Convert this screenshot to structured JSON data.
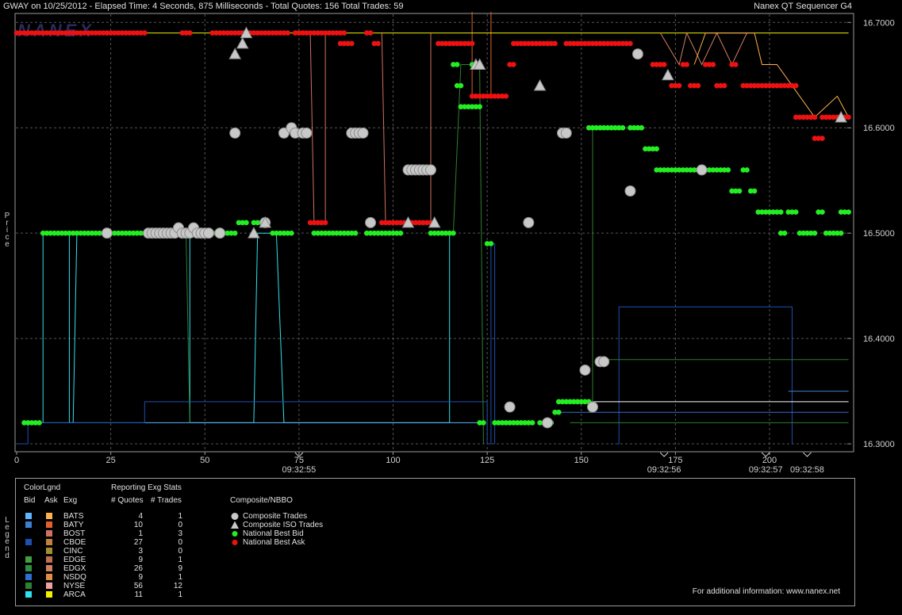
{
  "header": {
    "title": "GWAY on 10/25/2012  -  Elapsed Time: 4 Seconds, 875 Milliseconds  -  Total Quotes: 156  Total Trades: 59",
    "app_name": "Nanex QT Sequencer G4",
    "logo_text": "NANEX"
  },
  "axis_labels": {
    "y": "Price",
    "legend_side": "Legend"
  },
  "legend": {
    "colorlgnd_title": "ColorLgnd",
    "stats_title": "Reporting Exg Stats",
    "col_bid": "Bid",
    "col_ask": "Ask",
    "col_exg": "Exg",
    "col_quotes": "# Quotes",
    "col_trades": "# Trades",
    "composite_title": "Composite/NBBO",
    "rows": [
      {
        "exg": "BATS",
        "quotes": "4",
        "trades": "1",
        "bid_color": "#5fb4ff",
        "ask_color": "#ffb050"
      },
      {
        "exg": "BATY",
        "quotes": "10",
        "trades": "0",
        "bid_color": "#3f7fd0",
        "ask_color": "#e06030"
      },
      {
        "exg": "BOST",
        "quotes": "1",
        "trades": "3",
        "bid_color": "#000000",
        "ask_color": "#d07060"
      },
      {
        "exg": "CBOE",
        "quotes": "27",
        "trades": "0",
        "bid_color": "#1f4fb0",
        "ask_color": "#c08040"
      },
      {
        "exg": "CINC",
        "quotes": "3",
        "trades": "0",
        "bid_color": "#000000",
        "ask_color": "#a09030"
      },
      {
        "exg": "EDGE",
        "quotes": "9",
        "trades": "1",
        "bid_color": "#3fa040",
        "ask_color": "#c07050"
      },
      {
        "exg": "EDGX",
        "quotes": "26",
        "trades": "9",
        "bid_color": "#2f8f40",
        "ask_color": "#d08060"
      },
      {
        "exg": "NSDQ",
        "quotes": "9",
        "trades": "1",
        "bid_color": "#2f6fd0",
        "ask_color": "#e09040"
      },
      {
        "exg": "NYSE",
        "quotes": "56",
        "trades": "12",
        "bid_color": "#2f7f30",
        "ask_color": "#f0a0a0"
      },
      {
        "exg": "ARCA",
        "quotes": "11",
        "trades": "1",
        "bid_color": "#30e0f0",
        "ask_color": "#f0f000"
      }
    ],
    "composite": [
      {
        "label": "Composite Trades",
        "marker": "circle",
        "color": "#c8c8c8"
      },
      {
        "label": "Composite ISO Trades",
        "marker": "triangle",
        "color": "#c8c8c8"
      },
      {
        "label": "National Best Bid",
        "marker": "dot",
        "color": "#22ee22"
      },
      {
        "label": "National Best Ask",
        "marker": "dot",
        "color": "#ee1111"
      }
    ],
    "footer": "For additional information: www.nanex.net"
  },
  "colors": {
    "bid": "#22ee22",
    "ask": "#ee1111",
    "trade": "#c8c8c8",
    "grid": "#555555"
  },
  "chart_data": {
    "type": "scatter",
    "x_ticks": [
      "0",
      "25",
      "50",
      "75",
      "100",
      "125",
      "150",
      "175",
      "200"
    ],
    "y_ticks": [
      "16.3000",
      "16.4000",
      "16.5000",
      "16.6000",
      "16.7000"
    ],
    "time_labels": [
      {
        "x": 75,
        "label": "09:32:55"
      },
      {
        "x": 172,
        "label": "09:32:56"
      },
      {
        "x": 199,
        "label": "09:32:57"
      },
      {
        "x": 210,
        "label": "09:32:58"
      }
    ],
    "xlim": [
      0,
      221
    ],
    "ylim": [
      16.2925,
      16.7085
    ],
    "ask_segments": [
      [
        0,
        24,
        16.69
      ],
      [
        24,
        34,
        16.69
      ],
      [
        44,
        46,
        16.69
      ],
      [
        52,
        60,
        16.69
      ],
      [
        61,
        72,
        16.69
      ],
      [
        74,
        80,
        16.69
      ],
      [
        81,
        84,
        16.69
      ],
      [
        85,
        87,
        16.69
      ],
      [
        78,
        82,
        16.51
      ],
      [
        86,
        89,
        16.68
      ],
      [
        93,
        94,
        16.69
      ],
      [
        95,
        96,
        16.68
      ],
      [
        97,
        103,
        16.51
      ],
      [
        104,
        110,
        16.51
      ],
      [
        112,
        121,
        16.68
      ],
      [
        121,
        126,
        16.63
      ],
      [
        126,
        130,
        16.63
      ],
      [
        131,
        132,
        16.66
      ],
      [
        132,
        137,
        16.68
      ],
      [
        138,
        143,
        16.68
      ],
      [
        146,
        152,
        16.68
      ],
      [
        153,
        163,
        16.68
      ],
      [
        169,
        172,
        16.66
      ],
      [
        174,
        176,
        16.64
      ],
      [
        177,
        178,
        16.66
      ],
      [
        179,
        181,
        16.64
      ],
      [
        183,
        185,
        16.66
      ],
      [
        186,
        188,
        16.64
      ],
      [
        190,
        191,
        16.66
      ],
      [
        193,
        196,
        16.64
      ],
      [
        196,
        207,
        16.64
      ],
      [
        207,
        212,
        16.61
      ],
      [
        212,
        214,
        16.59
      ],
      [
        214,
        221,
        16.61
      ]
    ],
    "bid_segments": [
      [
        2,
        6,
        16.32
      ],
      [
        7,
        24,
        16.5
      ],
      [
        25,
        36,
        16.5
      ],
      [
        42,
        46,
        16.5
      ],
      [
        52,
        58,
        16.5
      ],
      [
        59,
        61,
        16.51
      ],
      [
        63,
        66,
        16.51
      ],
      [
        68,
        69,
        16.5
      ],
      [
        70,
        71,
        16.5
      ],
      [
        72,
        73,
        16.5
      ],
      [
        79,
        90,
        16.5
      ],
      [
        93,
        94,
        16.5
      ],
      [
        95,
        102,
        16.5
      ],
      [
        110,
        116,
        16.5
      ],
      [
        116,
        117,
        16.66
      ],
      [
        117,
        118,
        16.64
      ],
      [
        118,
        119,
        16.62
      ],
      [
        120,
        121,
        16.62
      ],
      [
        121,
        122,
        16.66
      ],
      [
        122,
        123,
        16.62
      ],
      [
        123,
        124,
        16.32
      ],
      [
        125,
        126,
        16.49
      ],
      [
        127,
        137,
        16.32
      ],
      [
        139,
        142,
        16.32
      ],
      [
        143,
        144,
        16.33
      ],
      [
        144,
        152,
        16.34
      ],
      [
        152,
        161,
        16.6
      ],
      [
        163,
        166,
        16.6
      ],
      [
        167,
        170,
        16.58
      ],
      [
        170,
        172,
        16.56
      ],
      [
        173,
        185,
        16.56
      ],
      [
        186,
        189,
        16.56
      ],
      [
        190,
        192,
        16.54
      ],
      [
        193,
        194,
        16.56
      ],
      [
        195,
        196,
        16.54
      ],
      [
        197,
        203,
        16.52
      ],
      [
        203,
        204,
        16.5
      ],
      [
        205,
        207,
        16.52
      ],
      [
        208,
        212,
        16.5
      ],
      [
        213,
        214,
        16.52
      ],
      [
        215,
        219,
        16.5
      ],
      [
        219,
        220,
        16.52
      ],
      [
        221,
        221,
        16.52
      ]
    ],
    "trades": [
      [
        24,
        16.5
      ],
      [
        35,
        16.5
      ],
      [
        36,
        16.5
      ],
      [
        37,
        16.5
      ],
      [
        38,
        16.5
      ],
      [
        39,
        16.5
      ],
      [
        40,
        16.5
      ],
      [
        41,
        16.5
      ],
      [
        42,
        16.5
      ],
      [
        43,
        16.505
      ],
      [
        44,
        16.5
      ],
      [
        45,
        16.5
      ],
      [
        46,
        16.5
      ],
      [
        47,
        16.505
      ],
      [
        48,
        16.5
      ],
      [
        49,
        16.5
      ],
      [
        50,
        16.5
      ],
      [
        51,
        16.5
      ],
      [
        54,
        16.5
      ],
      [
        58,
        16.595
      ],
      [
        66,
        16.51
      ],
      [
        71,
        16.595
      ],
      [
        73,
        16.6
      ],
      [
        74,
        16.595
      ],
      [
        76,
        16.595
      ],
      [
        77,
        16.595
      ],
      [
        89,
        16.595
      ],
      [
        90,
        16.595
      ],
      [
        91,
        16.595
      ],
      [
        92,
        16.595
      ],
      [
        94,
        16.51
      ],
      [
        104,
        16.56
      ],
      [
        105,
        16.56
      ],
      [
        106,
        16.56
      ],
      [
        107,
        16.56
      ],
      [
        108,
        16.56
      ],
      [
        109,
        16.56
      ],
      [
        110,
        16.56
      ],
      [
        131,
        16.335
      ],
      [
        136,
        16.51
      ],
      [
        141,
        16.32
      ],
      [
        145,
        16.595
      ],
      [
        146,
        16.595
      ],
      [
        151,
        16.37
      ],
      [
        153,
        16.335
      ],
      [
        155,
        16.378
      ],
      [
        156,
        16.378
      ],
      [
        163,
        16.54
      ],
      [
        165,
        16.67
      ],
      [
        182,
        16.56
      ]
    ],
    "iso_trades": [
      [
        58,
        16.67
      ],
      [
        60,
        16.68
      ],
      [
        61,
        16.69
      ],
      [
        63,
        16.5
      ],
      [
        66,
        16.51
      ],
      [
        104,
        16.51
      ],
      [
        111,
        16.51
      ],
      [
        122,
        16.66
      ],
      [
        123,
        16.66
      ],
      [
        139,
        16.64
      ],
      [
        173,
        16.65
      ],
      [
        219,
        16.61
      ]
    ],
    "exchange_lines": [
      {
        "color": "#30e0f0",
        "points": [
          [
            2,
            16.32
          ],
          [
            7,
            16.32
          ],
          [
            7,
            16.5
          ],
          [
            14,
            16.5
          ],
          [
            14,
            16.32
          ],
          [
            15,
            16.32
          ],
          [
            16,
            16.5
          ],
          [
            44,
            16.5
          ],
          [
            46,
            16.5
          ],
          [
            46,
            16.32
          ],
          [
            63,
            16.32
          ],
          [
            64,
            16.5
          ],
          [
            69,
            16.5
          ],
          [
            71,
            16.32
          ],
          [
            115,
            16.32
          ],
          [
            115,
            16.5
          ],
          [
            116,
            16.5
          ]
        ]
      },
      {
        "color": "#5fb4ff",
        "points": [
          [
            7,
            16.32
          ],
          [
            114,
            16.32
          ],
          [
            123,
            16.32
          ]
        ]
      },
      {
        "color": "#1f4fb0",
        "points": [
          [
            0,
            16.3
          ],
          [
            3,
            16.3
          ],
          [
            3,
            16.32
          ],
          [
            34,
            16.32
          ],
          [
            34,
            16.34
          ],
          [
            125,
            16.34
          ],
          [
            125,
            16.3
          ],
          [
            126,
            16.3
          ],
          [
            126,
            16.49
          ],
          [
            127,
            16.49
          ],
          [
            127,
            16.3
          ]
        ]
      },
      {
        "color": "#1f4fb0",
        "points": [
          [
            159,
            16.3
          ],
          [
            160,
            16.3
          ],
          [
            160,
            16.43
          ],
          [
            206,
            16.43
          ],
          [
            206,
            16.3
          ]
        ]
      },
      {
        "color": "#2f6fd0",
        "points": [
          [
            144,
            16.33
          ],
          [
            221,
            16.33
          ]
        ]
      },
      {
        "color": "#3f7fd0",
        "points": [
          [
            205,
            16.35
          ],
          [
            206,
            16.35
          ],
          [
            221,
            16.35
          ]
        ]
      },
      {
        "color": "#ffffff",
        "points": [
          [
            144,
            16.34
          ],
          [
            221,
            16.34
          ]
        ]
      },
      {
        "color": "#2f7f30",
        "points": [
          [
            46,
            16.32
          ],
          [
            45,
            16.5
          ]
        ]
      },
      {
        "color": "#2f7f30",
        "points": [
          [
            152,
            16.33
          ],
          [
            153,
            16.33
          ],
          [
            153,
            16.6
          ],
          [
            154,
            16.6
          ]
        ]
      },
      {
        "color": "#2f7f30",
        "points": [
          [
            155,
            16.38
          ],
          [
            221,
            16.38
          ]
        ]
      },
      {
        "color": "#2f7f30",
        "points": [
          [
            147,
            16.32
          ],
          [
            221,
            16.32
          ]
        ]
      },
      {
        "color": "#2f7f30",
        "points": [
          [
            116,
            16.5
          ],
          [
            118,
            16.66
          ],
          [
            123,
            16.66
          ],
          [
            124,
            16.3
          ]
        ]
      },
      {
        "color": "#d07060",
        "points": [
          [
            78,
            16.69
          ],
          [
            79,
            16.51
          ],
          [
            82,
            16.51
          ],
          [
            82,
            16.69
          ]
        ]
      },
      {
        "color": "#d07060",
        "points": [
          [
            97,
            16.69
          ],
          [
            98,
            16.51
          ],
          [
            110,
            16.51
          ],
          [
            110,
            16.69
          ]
        ]
      },
      {
        "color": "#e06030",
        "points": [
          [
            121,
            16.71
          ],
          [
            121,
            16.63
          ],
          [
            126,
            16.63
          ],
          [
            126,
            16.71
          ]
        ]
      },
      {
        "color": "#f0f000",
        "points": [
          [
            0,
            16.69
          ],
          [
            221,
            16.69
          ]
        ]
      },
      {
        "color": "#d08060",
        "points": [
          [
            171,
            16.69
          ],
          [
            176,
            16.66
          ],
          [
            178,
            16.69
          ],
          [
            182,
            16.66
          ],
          [
            186,
            16.69
          ],
          [
            190,
            16.66
          ],
          [
            194,
            16.69
          ]
        ]
      },
      {
        "color": "#ffb050",
        "points": [
          [
            180,
            16.66
          ],
          [
            183,
            16.69
          ],
          [
            196,
            16.69
          ],
          [
            198,
            16.66
          ],
          [
            202,
            16.66
          ],
          [
            206,
            16.64
          ],
          [
            212,
            16.61
          ],
          [
            218,
            16.63
          ],
          [
            221,
            16.61
          ]
        ]
      }
    ]
  }
}
